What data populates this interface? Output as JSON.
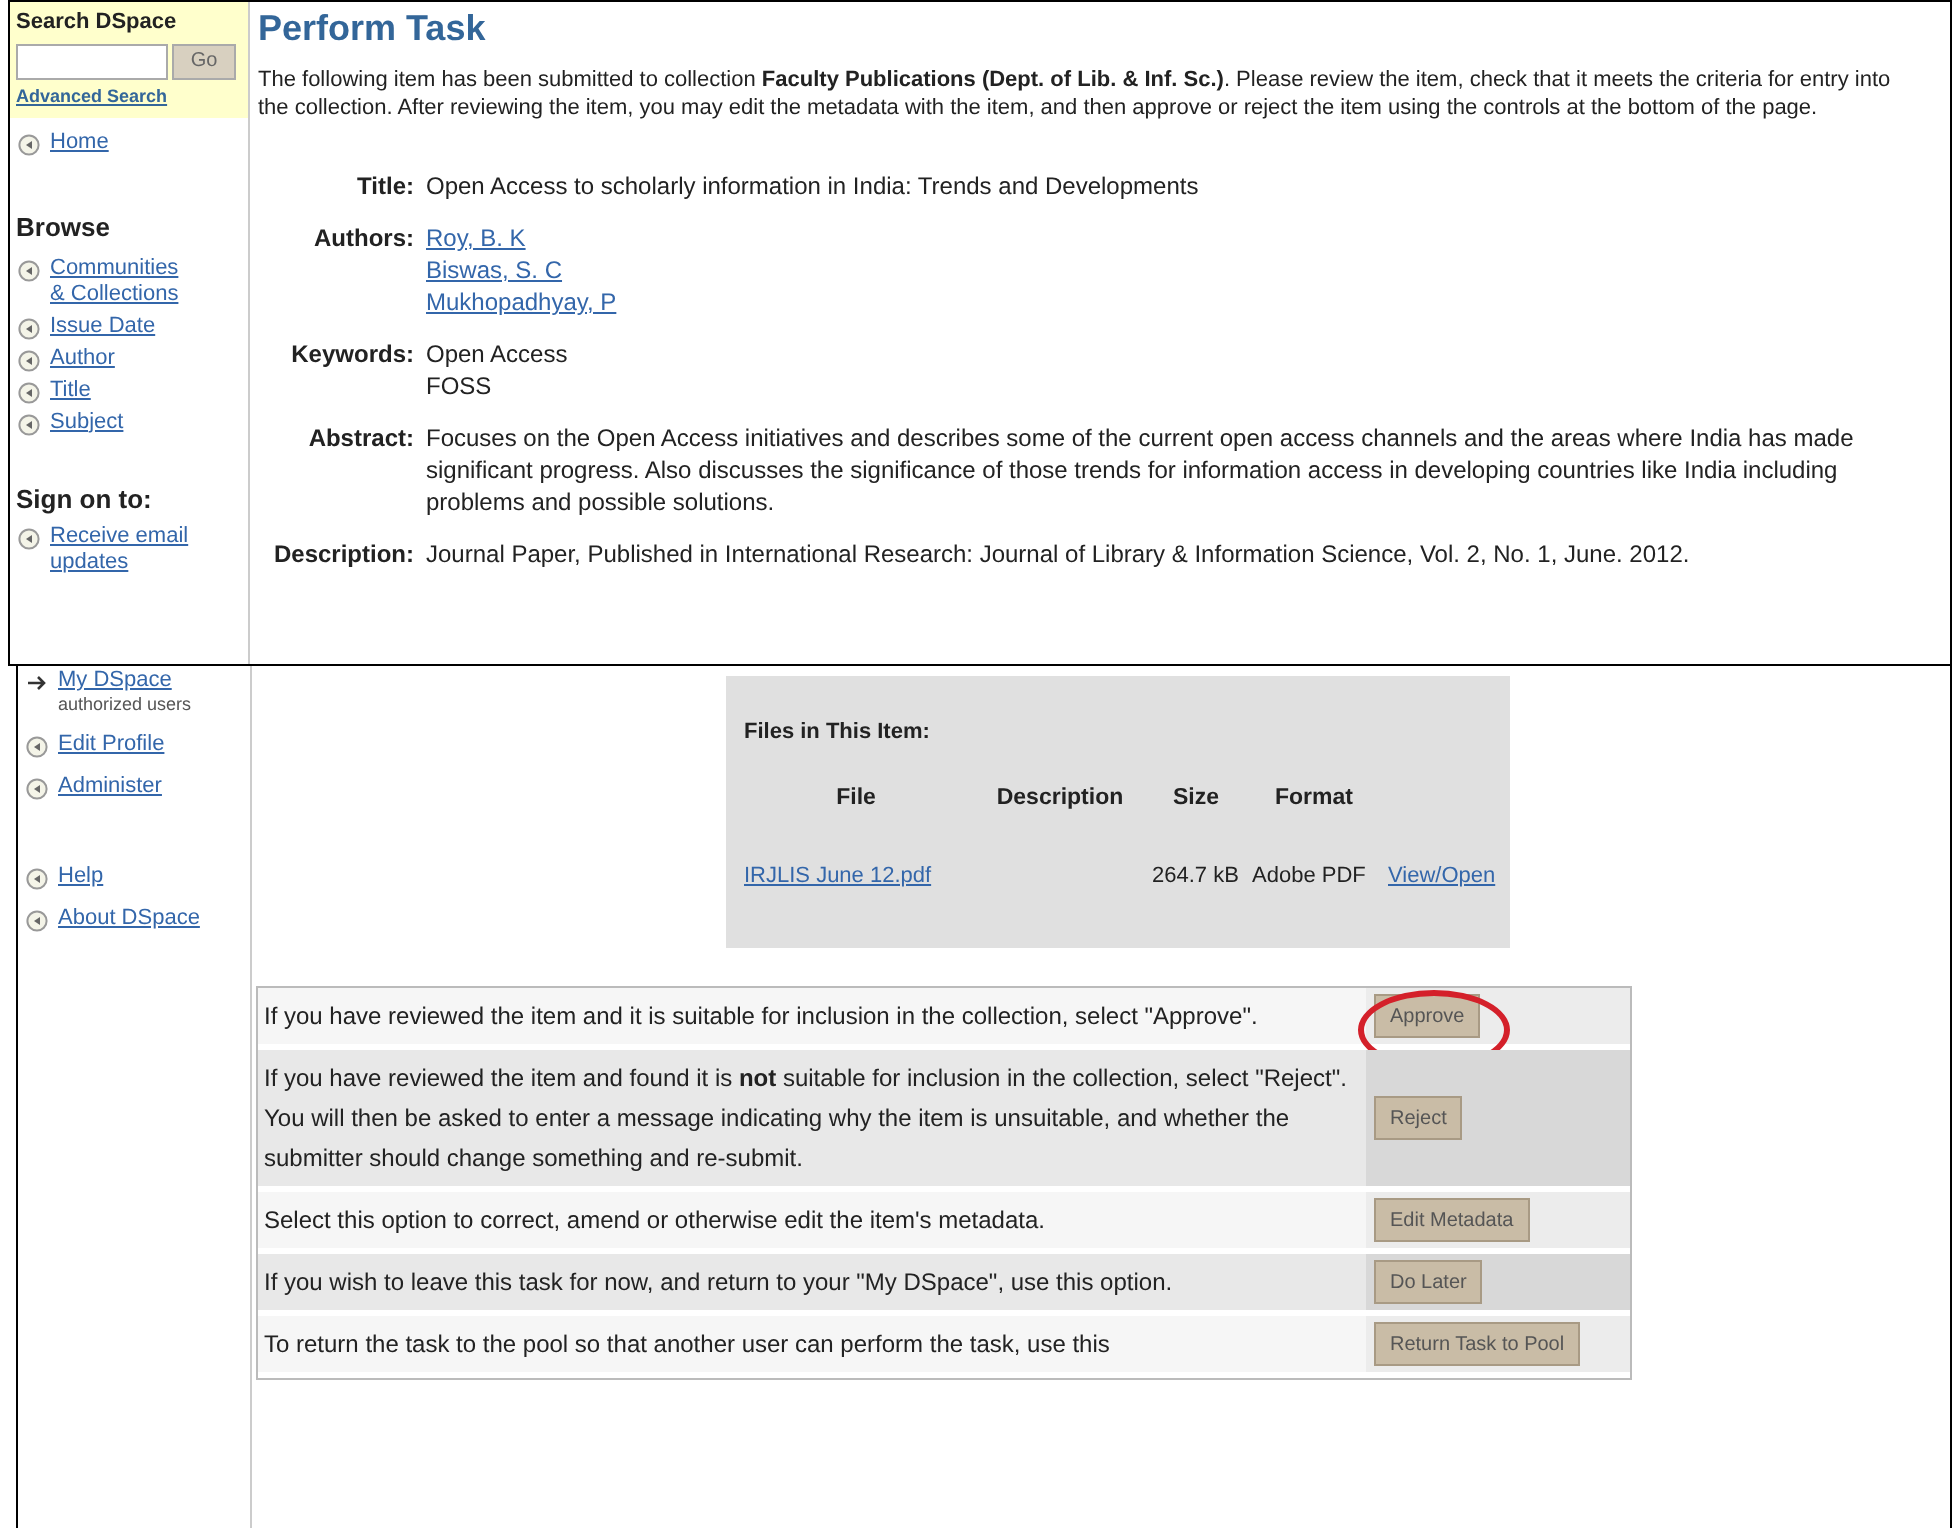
{
  "sidebar": {
    "search": {
      "heading": "Search DSpace",
      "button": "Go",
      "advanced_link": "Advanced Search"
    },
    "home": "Home",
    "browse": {
      "heading": "Browse",
      "items": [
        "Communities & Collections",
        "Issue Date",
        "Author",
        "Title",
        "Subject"
      ]
    },
    "sign_on": {
      "heading": "Sign on to:",
      "items": [
        {
          "label": "Receive email updates",
          "kind": "bullet"
        },
        {
          "label": "My DSpace",
          "note": "authorized users",
          "kind": "arrow"
        },
        {
          "label": "Edit Profile",
          "kind": "bullet"
        },
        {
          "label": "Administer",
          "kind": "bullet"
        }
      ]
    },
    "help_items": [
      "Help",
      "About DSpace"
    ]
  },
  "main": {
    "title": "Perform Task",
    "intro": "The following item has been submitted to collection **Faculty Publications (Dept. of Lib. & Inf. Sc.)**. Please review the item, check that it meets the criteria for entry into the collection. After reviewing the item, you may edit the metadata with the item, and then approve or reject the item using the controls at the bottom of the page.",
    "metadata": [
      {
        "label": "Title:",
        "kind": "text",
        "values": [
          "Open Access to scholarly information in India: Trends and Developments"
        ]
      },
      {
        "label": "Authors:",
        "kind": "link",
        "values": [
          "Roy, B. K",
          "Biswas, S. C",
          "Mukhopadhyay, P"
        ]
      },
      {
        "label": "Keywords:",
        "kind": "text",
        "values": [
          "Open Access",
          "FOSS"
        ]
      },
      {
        "label": "Abstract:",
        "kind": "text",
        "values": [
          "Focuses on the Open Access initiatives and describes some of the current open access channels and the areas where India has made significant progress. Also discusses the significance of those trends for information access in developing countries like India including problems and possible solutions."
        ]
      },
      {
        "label": "Description:",
        "kind": "text",
        "values": [
          "Journal Paper, Published in International Research: Journal of Library & Information Science, Vol. 2, No. 1, June. 2012."
        ]
      }
    ]
  },
  "files": {
    "heading": "Files in This Item:",
    "columns": [
      "File",
      "Description",
      "Size",
      "Format"
    ],
    "rows": [
      {
        "file": "IRJLIS June 12.pdf",
        "size": "264.7 kB",
        "format": "Adobe PDF",
        "action": "View/Open"
      }
    ]
  },
  "actions": [
    {
      "text": "If you have reviewed the item and it is suitable for inclusion in the collection, select \"Approve\".",
      "button": "Approve",
      "highlighted": true
    },
    {
      "text": "If you have reviewed the item and found it is **not** suitable for inclusion in the collection, select \"Reject\". You will then be asked to enter a message indicating why the item is unsuitable, and whether the submitter should change something and re-submit.",
      "button": "Reject",
      "highlighted": false
    },
    {
      "text": "Select this option to correct, amend or otherwise edit the item's metadata.",
      "button": "Edit Metadata",
      "highlighted": false
    },
    {
      "text": "If you wish to leave this task for now, and return to your \"My DSpace\", use this option.",
      "button": "Do Later",
      "highlighted": false
    },
    {
      "text": "To return the task to the pool so that another user can perform the task, use this",
      "button": "Return Task to Pool",
      "highlighted": false
    }
  ]
}
